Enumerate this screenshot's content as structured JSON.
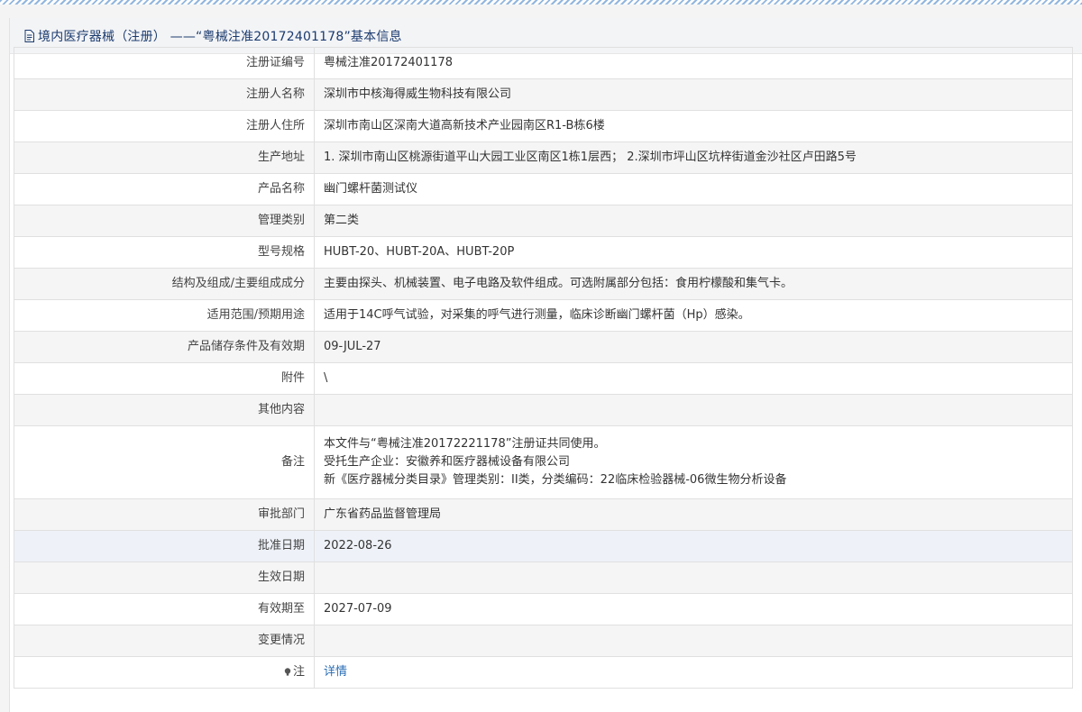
{
  "header": {
    "title": "境内医疗器械（注册） ——“粤械注准20172401178”基本信息",
    "icon": "document-icon"
  },
  "rows": [
    {
      "label": "注册证编号",
      "value": "粤械注准20172401178"
    },
    {
      "label": "注册人名称",
      "value": "深圳市中核海得威生物科技有限公司"
    },
    {
      "label": "注册人住所",
      "value": "深圳市南山区深南大道高新技术产业园南区R1-B栋6楼"
    },
    {
      "label": "生产地址",
      "value": "1. 深圳市南山区桃源街道平山大园工业区南区1栋1层西； 2.深圳市坪山区坑梓街道金沙社区卢田路5号"
    },
    {
      "label": "产品名称",
      "value": "幽门螺杆菌测试仪"
    },
    {
      "label": "管理类别",
      "value": "第二类"
    },
    {
      "label": "型号规格",
      "value": "HUBT-20、HUBT-20A、HUBT-20P"
    },
    {
      "label": "结构及组成/主要组成成分",
      "value": "主要由探头、机械装置、电子电路及软件组成。可选附属部分包括：食用柠檬酸和集气卡。"
    },
    {
      "label": "适用范围/预期用途",
      "value": "适用于14C呼气试验，对采集的呼气进行测量，临床诊断幽门螺杆菌（Hp）感染。"
    },
    {
      "label": "产品储存条件及有效期",
      "value": "09-JUL-27"
    },
    {
      "label": "附件",
      "value": "\\"
    },
    {
      "label": "其他内容",
      "value": ""
    }
  ],
  "remark": {
    "label": "备注",
    "lines": [
      "本文件与“粤械注准20172221178”注册证共同使用。",
      "受托生产企业：安徽养和医疗器械设备有限公司",
      "新《医疗器械分类目录》管理类别：II类，分类编码：22临床检验器械-06微生物分析设备"
    ]
  },
  "rows2": [
    {
      "label": "审批部门",
      "value": "广东省药品监督管理局"
    },
    {
      "label": "批准日期",
      "value": "2022-08-26"
    },
    {
      "label": "生效日期",
      "value": ""
    },
    {
      "label": "有效期至",
      "value": "2027-07-09"
    },
    {
      "label": "变更情况",
      "value": ""
    }
  ],
  "footnote": {
    "label": "注",
    "icon": "lightbulb-icon",
    "link": "详情"
  }
}
